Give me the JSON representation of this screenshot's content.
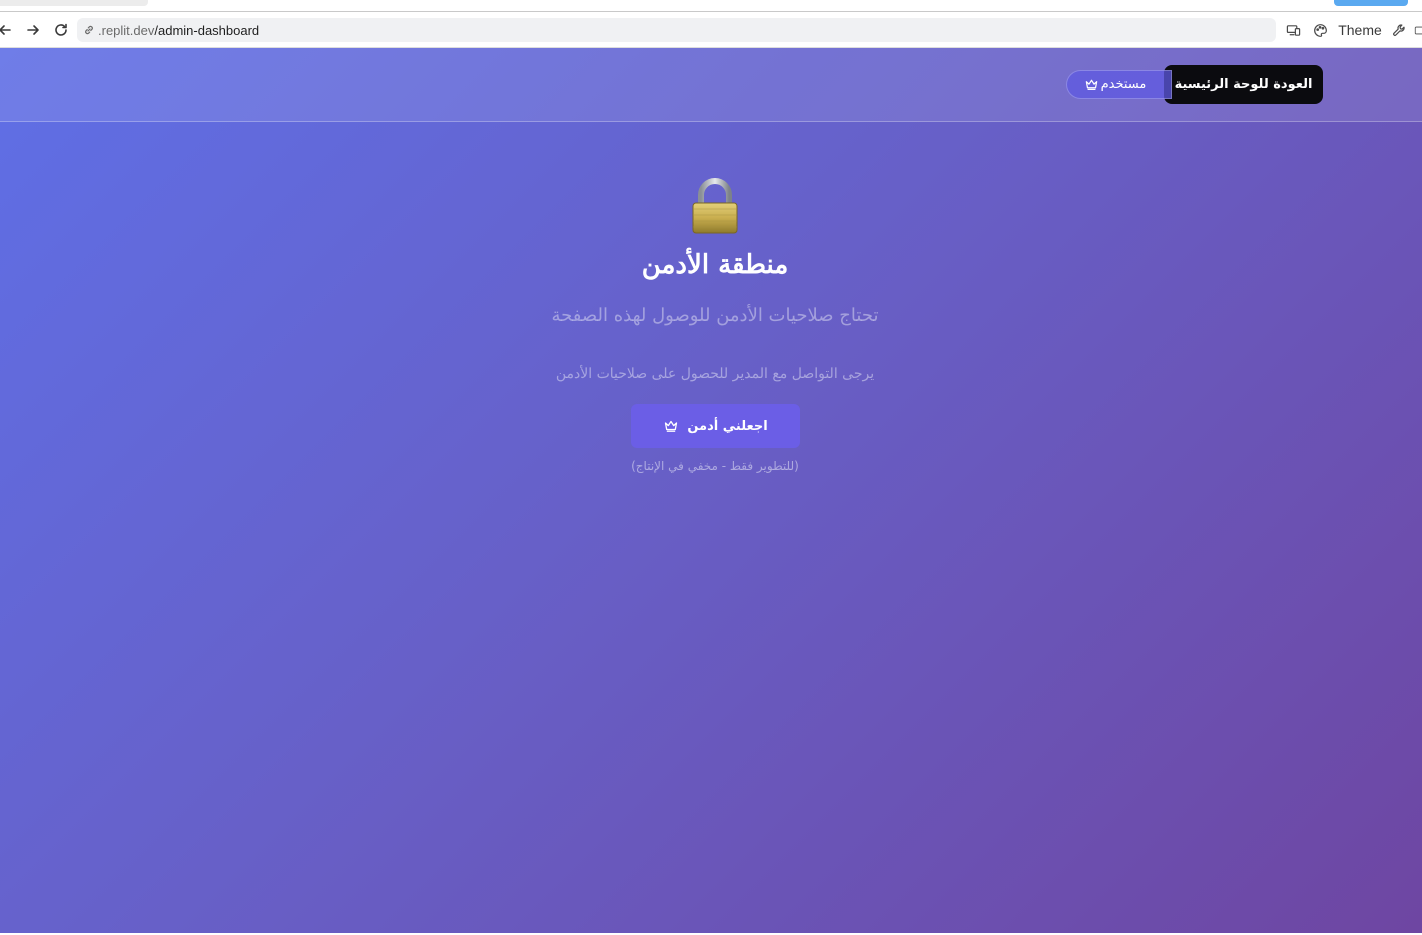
{
  "browser": {
    "url_host": ".replit.dev",
    "url_path": "/admin-dashboard",
    "theme_label": "Theme",
    "icons": {
      "back": "arrow-left-icon",
      "forward": "arrow-right-icon",
      "reload": "reload-icon",
      "link": "link-icon",
      "devices": "devices-icon",
      "palette": "palette-icon",
      "wrench": "wrench-icon"
    }
  },
  "header": {
    "back_button_label": "العودة للوحة الرئيسية",
    "role_badge_label": "مستخدم",
    "role_badge_icon": "crown-icon"
  },
  "main": {
    "lock_icon": "lock-icon",
    "title": "منطقة الأدمن",
    "subtitle": "تحتاج صلاحيات الأدمن للوصول لهذه الصفحة",
    "contact_note": "يرجى التواصل مع المدير للحصول على صلاحيات الأدمن",
    "make_admin_button_label": "اجعلني أدمن",
    "make_admin_button_icon": "crown-icon",
    "dev_note": "(للتطوير فقط - مخفي في الإنتاج)"
  },
  "colors": {
    "gradient_start": "#5f6fe6",
    "gradient_end": "#6e46a2",
    "back_button_bg": "#0b0b0f",
    "primary_button_bg": "#6b5ee6"
  }
}
